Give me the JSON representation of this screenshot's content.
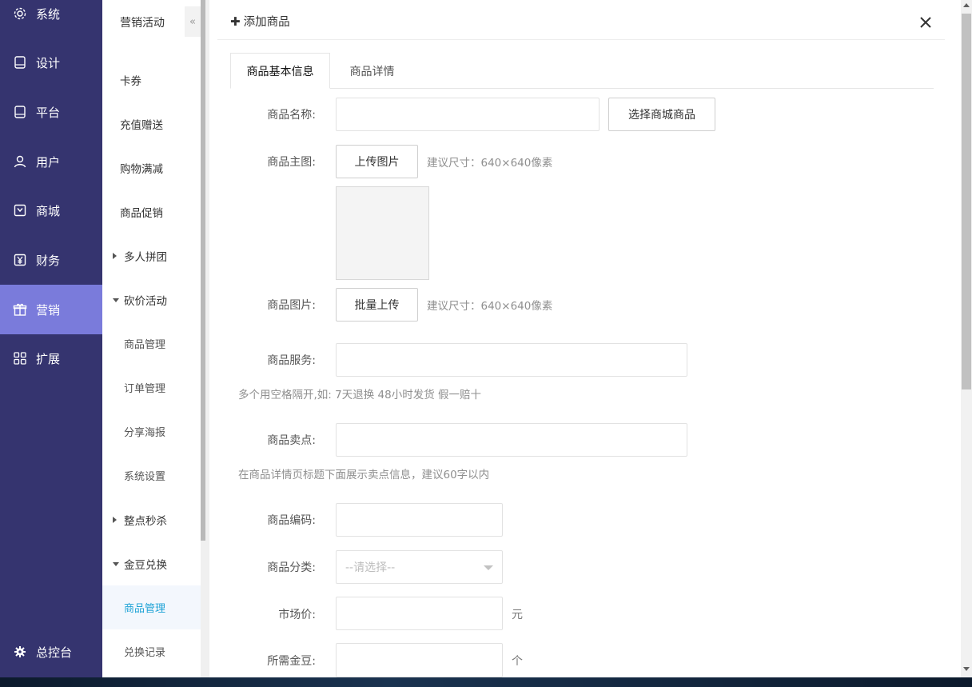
{
  "nav_primary": {
    "items": [
      {
        "label": "系统",
        "icon": "gear-icon"
      },
      {
        "label": "设计",
        "icon": "tablet-icon"
      },
      {
        "label": "平台",
        "icon": "tablet-icon"
      },
      {
        "label": "用户",
        "icon": "user-icon"
      },
      {
        "label": "商城",
        "icon": "store-icon"
      },
      {
        "label": "财务",
        "icon": "yen-icon"
      },
      {
        "label": "营销",
        "icon": "gift-icon"
      },
      {
        "label": "扩展",
        "icon": "grid-icon"
      }
    ],
    "active": "营销",
    "footer_label": "总控台",
    "footer_icon": "gear-icon"
  },
  "nav_secondary": {
    "heading": "营销活动",
    "collapse_glyph": "«",
    "items": [
      {
        "label": "卡券"
      },
      {
        "label": "充值赠送"
      },
      {
        "label": "购物满减"
      },
      {
        "label": "商品促销"
      },
      {
        "label": "多人拼团"
      },
      {
        "label": "砍价活动"
      },
      {
        "label": "商品管理"
      },
      {
        "label": "订单管理"
      },
      {
        "label": "分享海报"
      },
      {
        "label": "系统设置"
      },
      {
        "label": "整点秒杀"
      },
      {
        "label": "金豆兑换"
      },
      {
        "label": "商品管理"
      },
      {
        "label": "兑换记录"
      }
    ],
    "selected": "商品管理 (金豆兑换)"
  },
  "modal": {
    "title": "添加商品",
    "tabs": [
      {
        "label": "商品基本信息",
        "active": true
      },
      {
        "label": "商品详情",
        "active": false
      }
    ]
  },
  "form": {
    "name_label": "商品名称:",
    "name_value": "",
    "pick_button": "选择商城商品",
    "main_image_label": "商品主图:",
    "upload_button": "上传图片",
    "main_image_hint": "建议尺寸：640×640像素",
    "images_label": "商品图片:",
    "batch_upload_button": "批量上传",
    "images_hint": "建议尺寸：640×640像素",
    "service_label": "商品服务:",
    "service_value": "",
    "service_help": "多个用空格隔开,如: 7天退换 48小时发货 假一赔十",
    "selling_label": "商品卖点:",
    "selling_value": "",
    "selling_help": "在商品详情页标题下面展示卖点信息，建议60字以内",
    "code_label": "商品编码:",
    "code_value": "",
    "category_label": "商品分类:",
    "category_placeholder": "--请选择--",
    "market_price_label": "市场价:",
    "market_price_value": "",
    "market_price_unit": "元",
    "beans_label": "所需金豆:",
    "beans_value": "",
    "beans_unit": "个"
  },
  "colors": {
    "sidebar_bg": "#35346f",
    "sidebar_active": "#7a7bdb",
    "selected_text": "#1fa3d6"
  }
}
